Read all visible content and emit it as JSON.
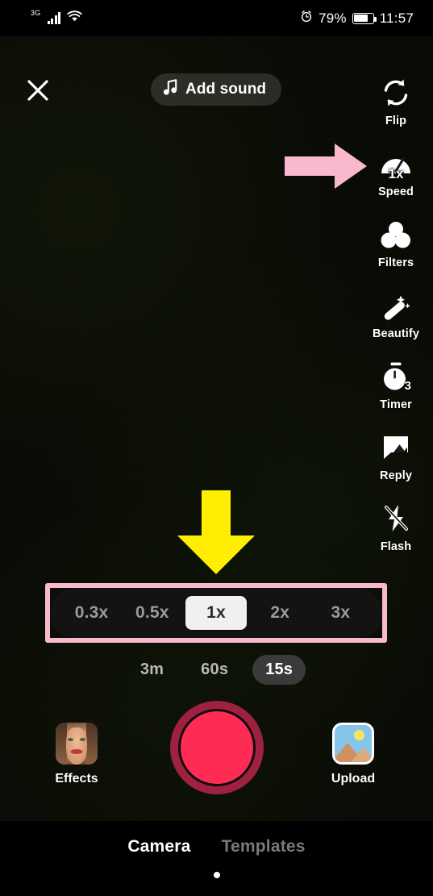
{
  "status_bar": {
    "network_type": "3G",
    "signal_icon": "signal-bars-icon",
    "wifi_icon": "wifi-icon",
    "alarm_icon": "alarm-icon",
    "battery_percent": "79%",
    "battery_icon": "battery-icon",
    "time": "11:57"
  },
  "top_bar": {
    "close_icon": "close-icon",
    "add_sound_label": "Add sound",
    "music_icon": "music-note-icon"
  },
  "tool_rail": [
    {
      "label": "Flip",
      "icon": "flip-camera-icon"
    },
    {
      "label": "Speed",
      "icon": "speedometer-icon",
      "value": "1x"
    },
    {
      "label": "Filters",
      "icon": "filters-icon"
    },
    {
      "label": "Beautify",
      "icon": "magic-wand-icon"
    },
    {
      "label": "Timer",
      "icon": "stopwatch-icon",
      "value": "3"
    },
    {
      "label": "Reply",
      "icon": "reply-icon"
    },
    {
      "label": "Flash",
      "icon": "flash-off-icon"
    }
  ],
  "annotations": {
    "right_arrow": {
      "name": "pink-right-arrow",
      "color": "#f8b9ce",
      "points_to": "Speed"
    },
    "down_arrow": {
      "name": "yellow-down-arrow",
      "color": "#ffee00",
      "points_to": "speed selector"
    },
    "highlight_box": {
      "name": "pink-highlight-box",
      "color": "#f8b9ce",
      "surrounds": "speed selector"
    }
  },
  "speed_selector": {
    "options": [
      "0.3x",
      "0.5x",
      "1x",
      "2x",
      "3x"
    ],
    "selected": "1x",
    "selected_index": 2
  },
  "duration_selector": {
    "options": [
      "3m",
      "60s",
      "15s"
    ],
    "selected": "15s",
    "selected_index": 2
  },
  "capture_row": {
    "effects_label": "Effects",
    "effects_icon": "effects-face-thumbnail-icon",
    "record_button": "record-button",
    "upload_label": "Upload",
    "upload_icon": "photo-thumbnail-icon"
  },
  "bottom_tabs": {
    "tabs": [
      "Camera",
      "Templates"
    ],
    "selected": "Camera",
    "selected_index": 0
  },
  "colors": {
    "record_red": "#fe2c55",
    "record_ring": "#9e2140",
    "annotation_pink": "#f8b9ce",
    "annotation_yellow": "#ffee00",
    "selected_chip": "#f0f0f0"
  }
}
